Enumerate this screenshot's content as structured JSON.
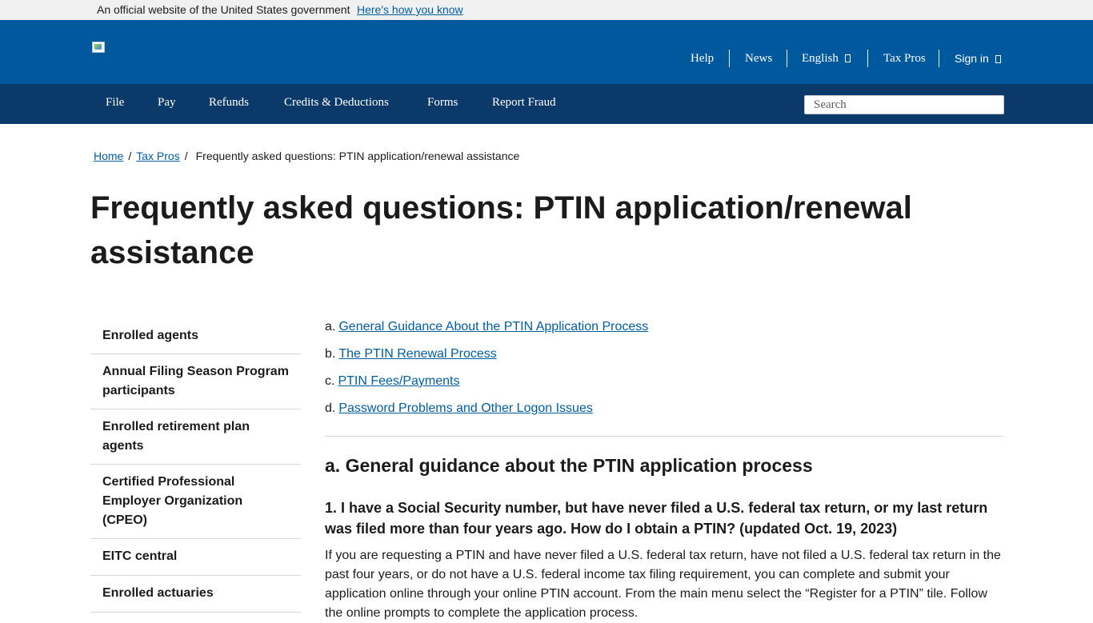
{
  "gov_banner": {
    "text": "An official website of the United States government",
    "link": "Here's how you know"
  },
  "utility_nav": {
    "help": "Help",
    "news": "News",
    "language": "English",
    "tax_pros": "Tax Pros",
    "sign_in": "Sign in"
  },
  "main_nav": {
    "items": [
      "File",
      "Pay",
      "Refunds",
      "Credits & Deductions",
      "Forms",
      "Report Fraud"
    ],
    "search_placeholder": "Search"
  },
  "breadcrumb": {
    "home": "Home",
    "tax_pros": "Tax Pros",
    "current": "Frequently asked questions: PTIN application/renewal assistance"
  },
  "page_title": "Frequently asked questions: PTIN application/renewal assistance",
  "sidebar": {
    "items": [
      "Enrolled agents",
      "Annual Filing Season Program participants",
      "Enrolled retirement plan agents",
      "Certified Professional Employer Organization (CPEO)",
      "EITC central",
      "Enrolled actuaries"
    ]
  },
  "toc": [
    {
      "prefix": "a.",
      "label": "General Guidance About the PTIN Application Process"
    },
    {
      "prefix": "b.",
      "label": "The PTIN Renewal Process"
    },
    {
      "prefix": "c.",
      "label": "PTIN Fees/Payments"
    },
    {
      "prefix": "d.",
      "label": "Password Problems and Other Logon Issues"
    }
  ],
  "section": {
    "heading": "a. General guidance about the PTIN application process",
    "question": "1. I have a Social Security number, but have never filed a U.S. federal tax return, or my last return was filed more than four years ago. How do I obtain a PTIN? (updated Oct. 19, 2023)",
    "answer": "If you are requesting a PTIN and have never filed a U.S. federal tax return, have not filed a U.S. federal tax return in the past four years, or do not have a U.S. federal income tax filing requirement, you can complete and submit your application online through your online PTIN account. From the main menu select the “Register for a PTIN” tile. Follow the online prompts to complete the application process."
  }
}
